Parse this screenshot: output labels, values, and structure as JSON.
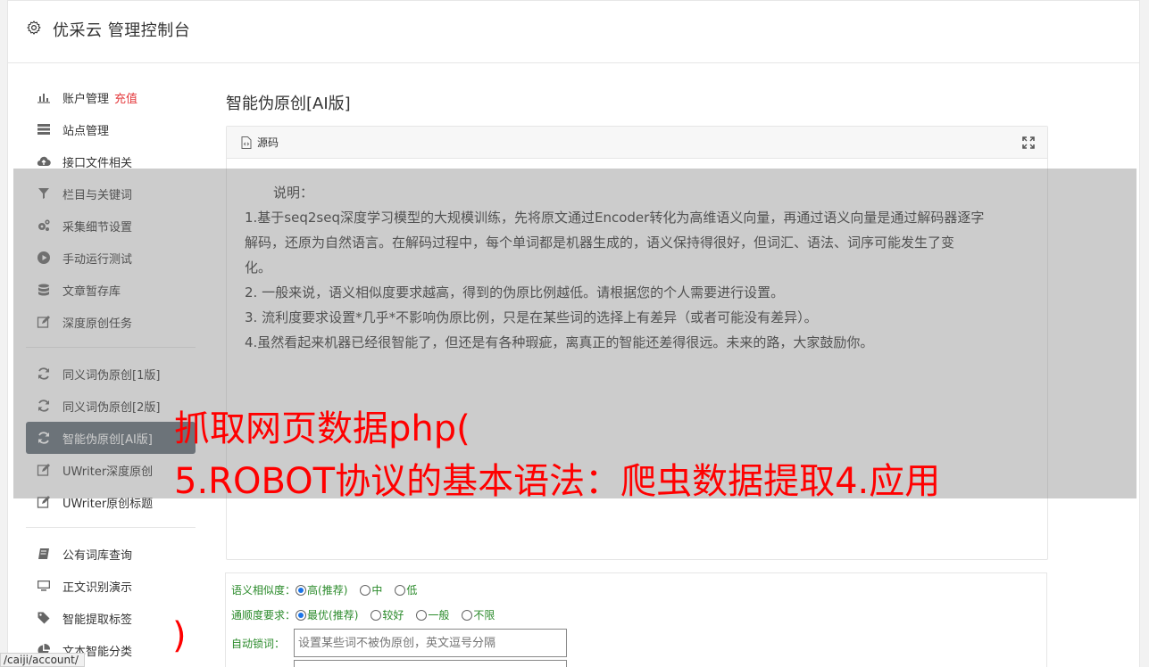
{
  "header": {
    "title": "优采云 管理控制台",
    "icon": "gear-icon"
  },
  "sidebar": {
    "items": [
      {
        "label": "账户管理",
        "badge": "充值",
        "icon": "bar-chart-icon"
      },
      {
        "label": "站点管理",
        "icon": "server-icon"
      },
      {
        "label": "接口文件相关",
        "icon": "cloud-upload-icon"
      },
      {
        "label": "栏目与关键词",
        "icon": "filter-icon"
      },
      {
        "label": "采集细节设置",
        "icon": "gears-icon"
      },
      {
        "label": "手动运行测试",
        "icon": "play-circle-icon"
      },
      {
        "label": "文章暂存库",
        "icon": "database-icon"
      },
      {
        "label": "深度原创任务",
        "icon": "edit-icon"
      }
    ],
    "items2": [
      {
        "label": "同义词伪原创[1版]",
        "icon": "refresh-icon"
      },
      {
        "label": "同义词伪原创[2版]",
        "icon": "refresh-icon"
      },
      {
        "label": "智能伪原创[AI版]",
        "icon": "refresh-icon",
        "active": true
      },
      {
        "label": "UWriter深度原创",
        "icon": "edit-icon"
      },
      {
        "label": "UWriter原创标题",
        "icon": "edit-icon"
      }
    ],
    "items3": [
      {
        "label": "公有词库查询",
        "icon": "book-icon"
      },
      {
        "label": "正文识别演示",
        "icon": "monitor-icon"
      },
      {
        "label": "智能提取标签",
        "icon": "tag-icon"
      },
      {
        "label": "文本智能分类",
        "icon": "pie-chart-icon"
      }
    ]
  },
  "main": {
    "title": "智能伪原创[AI版]",
    "panel": {
      "tab_label": "源码",
      "lines": [
        "说明：",
        "1.基于seq2seq深度学习模型的大规模训练，先将原文通过Encoder转化为高维语义向量，再通过语义向量是通过解码器逐字",
        "解码，还原为自然语言。在解码过程中，每个单词都是机器生成的，语义保持得很好，但词汇、语法、词序可能发生了变",
        "化。",
        "2. 一般来说，语义相似度要求越高，得到的伪原比例越低。请根据您的个人需要进行设置。",
        "3. 流利度要求设置*几乎*不影响伪原比例，只是在某些词的选择上有差异（或者可能没有差异）。",
        "4.虽然看起来机器已经很智能了，但还是有各种瑕疵，离真正的智能还差得很远。未来的路，大家鼓励你。"
      ]
    },
    "form": {
      "similarity": {
        "label": "语义相似度：",
        "options": [
          "高(推荐)",
          "中",
          "低"
        ],
        "selected": "高(推荐)"
      },
      "fluency": {
        "label": "通顺度要求：",
        "options": [
          "最优(推荐)",
          "较好",
          "一般",
          "不限"
        ],
        "selected": "最优(推荐)"
      },
      "lock": {
        "label": "自动锁词：",
        "placeholder": "设置某些词不被伪原创，英文逗号分隔"
      }
    }
  },
  "overlay": {
    "line1": "抓取网页数据php(",
    "line2": "5.ROBOT协议的基本语法：爬虫数据提取4.应用",
    "stray": ")"
  },
  "status_url": "/caiji/account/"
}
